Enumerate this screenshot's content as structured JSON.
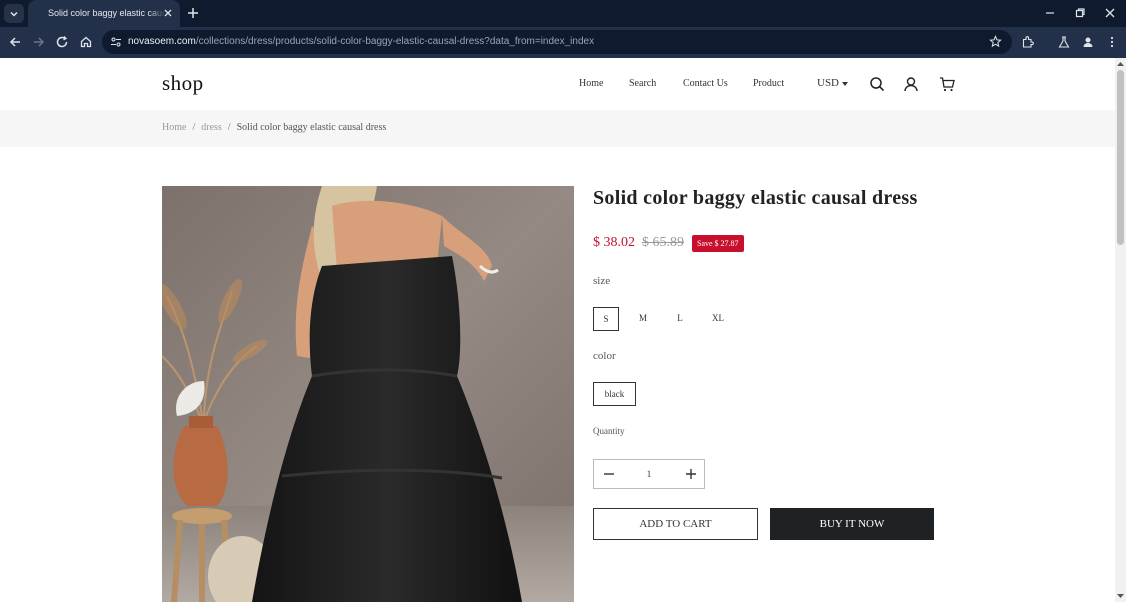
{
  "browser": {
    "tab_title": "Solid color baggy elastic causal dress",
    "url_host": "novasoem.com",
    "url_path": "/collections/dress/products/solid-color-baggy-elastic-causal-dress?data_from=index_index"
  },
  "header": {
    "logo": "shop",
    "nav": [
      "Home",
      "Search",
      "Contact Us",
      "Product"
    ],
    "currency": "USD"
  },
  "breadcrumb": {
    "home": "Home",
    "sep": "/",
    "category": "dress",
    "current": "Solid color baggy elastic causal dress"
  },
  "product": {
    "title": "Solid color baggy elastic causal dress",
    "price": "$ 38.02",
    "compare_price": "$ 65.89",
    "save_badge": "Save $ 27.87",
    "size_label": "size",
    "sizes": [
      "S",
      "M",
      "L",
      "XL"
    ],
    "selected_size": "S",
    "color_label": "color",
    "colors": [
      "black"
    ],
    "quantity_label": "Quantity",
    "quantity": "1",
    "add_to_cart": "ADD TO CART",
    "buy_now": "BUY IT NOW"
  },
  "colors": {
    "accent_red": "#c8102e",
    "dark_button": "#1f2224",
    "chrome_dark": "#0f1a2e",
    "chrome_toolbar": "#22304a"
  },
  "icons": [
    "search-icon",
    "user-icon",
    "cart-icon",
    "minus-icon",
    "plus-icon",
    "star-icon",
    "extensions-icon",
    "profile-icon",
    "menu-icon"
  ]
}
